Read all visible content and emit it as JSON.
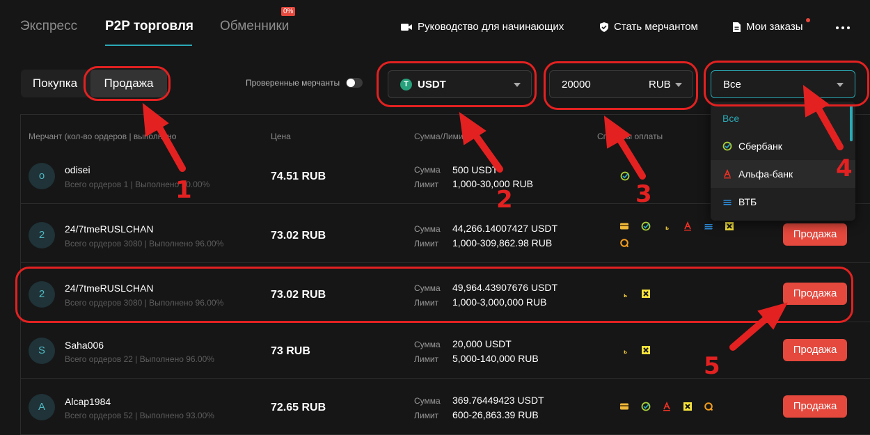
{
  "nav": {
    "tabs": [
      {
        "label": "Экспресс"
      },
      {
        "label": "P2P торговля"
      },
      {
        "label": "Обменники"
      }
    ],
    "exchanger_badge": "0%",
    "links": [
      {
        "label": "Руководство для начинающих",
        "icon": "video-camera-icon"
      },
      {
        "label": "Стать мерчантом",
        "icon": "shield-check-icon"
      },
      {
        "label": "Мои заказы",
        "icon": "document-icon"
      }
    ]
  },
  "filters": {
    "side_buy": "Покупка",
    "side_sell": "Продажа",
    "verified_label": "Проверенные мерчанты",
    "asset": "USDT",
    "amount": "20000",
    "fiat": "RUB",
    "payment": "Все"
  },
  "table": {
    "headers": {
      "merchant": "Мерчант (кол-во ордеров | выполнено",
      "price": "Цена",
      "amount": "Сумма/Лимит",
      "methods": "Способы оплаты"
    },
    "amount_label": "Сумма",
    "limit_label": "Лимит",
    "sell_label": "Продажа",
    "rows": [
      {
        "avatar": "o",
        "name": "odisei",
        "stats": "Всего ордеров 1 | Выполнено 50.00%",
        "price": "74.51 RUB",
        "amount": "500 USDT",
        "limit": "1,000-30,000 RUB"
      },
      {
        "avatar": "2",
        "name": "24/7tmeRUSLCHAN",
        "stats": "Всего ордеров 3080 | Выполнено 96.00%",
        "price": "73.02 RUB",
        "amount": "44,266.14007427 USDT",
        "limit": "1,000-309,862.98 RUB"
      },
      {
        "avatar": "2",
        "name": "24/7tmeRUSLCHAN",
        "stats": "Всего ордеров 3080 | Выполнено 96.00%",
        "price": "73.02 RUB",
        "amount": "49,964.43907676 USDT",
        "limit": "1,000-3,000,000 RUB"
      },
      {
        "avatar": "S",
        "name": "Saha006",
        "stats": "Всего ордеров 22 | Выполнено 96.00%",
        "price": "73 RUB",
        "amount": "20,000 USDT",
        "limit": "5,000-140,000 RUB"
      },
      {
        "avatar": "A",
        "name": "Alcap1984",
        "stats": "Всего ордеров 52 | Выполнено 93.00%",
        "price": "72.65 RUB",
        "amount": "369.76449423 USDT",
        "limit": "600-26,863.39 RUB"
      }
    ]
  },
  "dropdown": {
    "items": [
      {
        "label": "Все"
      },
      {
        "label": "Сбербанк"
      },
      {
        "label": "Альфа-банк"
      },
      {
        "label": "ВТБ"
      }
    ]
  },
  "annotations": [
    "1",
    "2",
    "3",
    "4",
    "5"
  ],
  "colors": {
    "accent": "#2aa9b6",
    "sell_button": "#e5483d",
    "annotation": "#e32121",
    "background": "#161616"
  }
}
